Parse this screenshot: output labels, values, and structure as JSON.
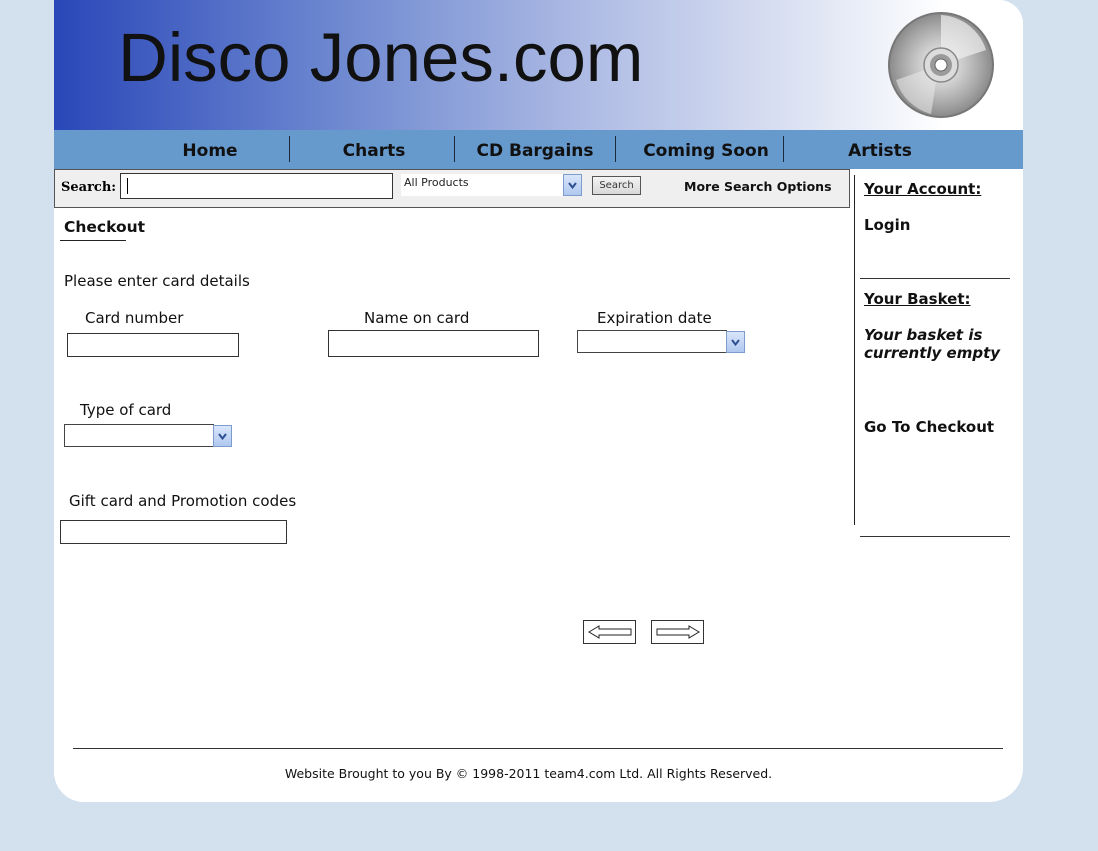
{
  "header": {
    "site_title": "Disco Jones.com",
    "logo_icon": "cd-disc-icon"
  },
  "nav": {
    "items": [
      "Home",
      "Charts",
      "CD Bargains",
      "Coming Soon",
      "Artists"
    ]
  },
  "search": {
    "label": "Search:",
    "input_value": "",
    "category_selected": "All Products",
    "button_label": "Search",
    "more_options": "More Search Options"
  },
  "checkout": {
    "heading": "Checkout",
    "instructions": "Please enter card details",
    "card_number_label": "Card number",
    "card_number_value": "",
    "name_on_card_label": "Name on card",
    "name_on_card_value": "",
    "expiration_label": "Expiration date",
    "expiration_value": "",
    "card_type_label": "Type of card",
    "card_type_value": "",
    "promo_label": "Gift card and Promotion codes",
    "promo_value": "",
    "back_icon": "left-arrow-icon",
    "next_icon": "right-arrow-icon"
  },
  "sidebar": {
    "account_heading": "Your Account:",
    "login": "Login",
    "basket_heading": "Your Basket:",
    "basket_status": "Your basket is currently empty",
    "checkout_link": "Go To Checkout"
  },
  "footer": {
    "text": "Website Brought to you By © 1998-2011 team4.com Ltd. All Rights Reserved."
  },
  "colors": {
    "page_bg": "#d3e1ef",
    "nav_bg": "#6699cc",
    "header_gradient_start": "#2a47b9"
  }
}
